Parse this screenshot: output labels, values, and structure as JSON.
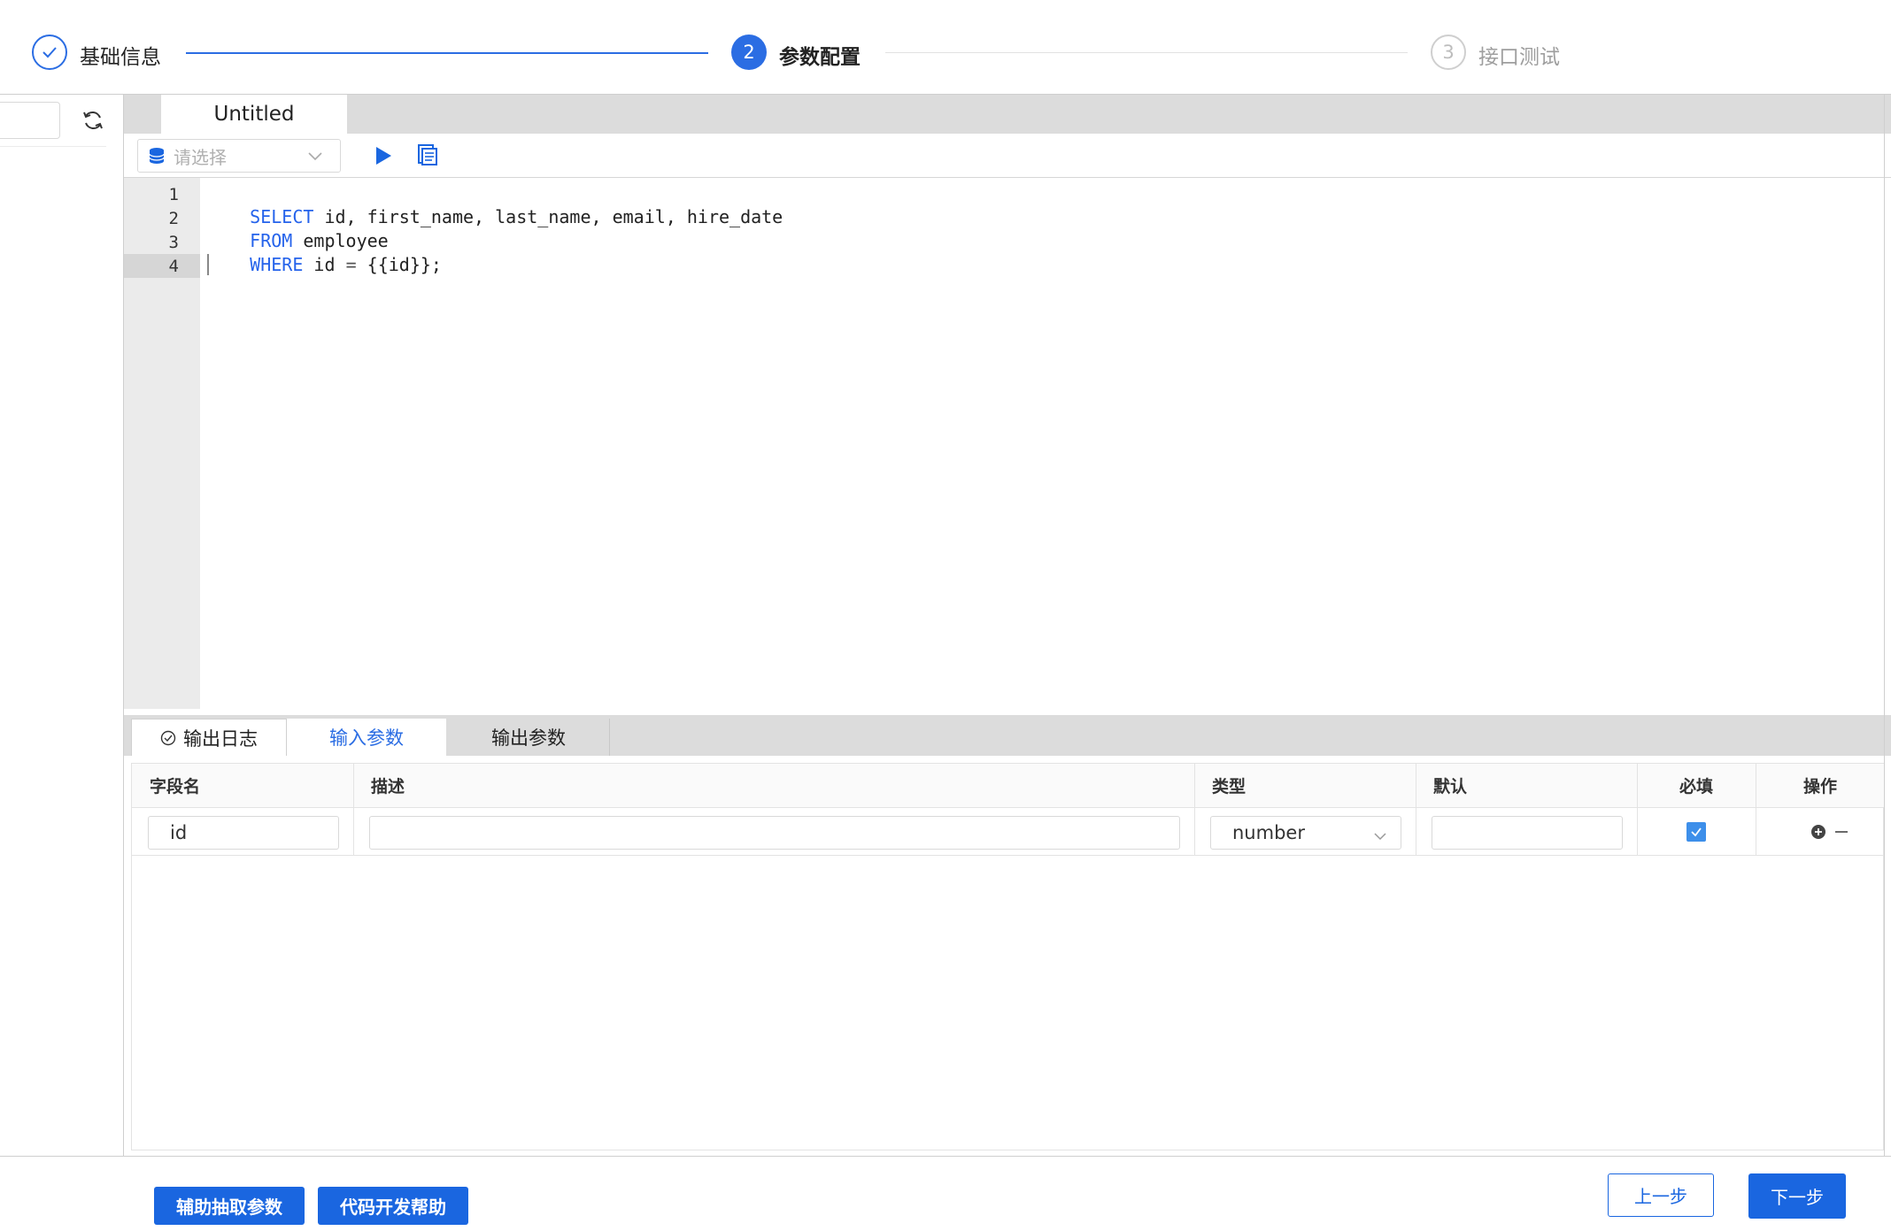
{
  "steps": [
    {
      "index": "1",
      "label": "基础信息",
      "state": "done"
    },
    {
      "index": "2",
      "label": "参数配置",
      "state": "active"
    },
    {
      "index": "3",
      "label": "接口测试",
      "state": "wait"
    }
  ],
  "editor": {
    "tab_title": "Untitled",
    "datasource_placeholder": "请选择",
    "line_numbers": [
      "1",
      "2",
      "3",
      "4"
    ],
    "code": {
      "l1_kw": "SELECT",
      "l1_rest": " id, first_name, last_name, email, hire_date",
      "l2_kw": "FROM",
      "l2_rest": " employee",
      "l3_kw": "WHERE",
      "l3_mid": " id ",
      "l3_op": "=",
      "l3_rest": " {{id}};"
    }
  },
  "bottom_tabs": [
    "输出日志",
    "输入参数",
    "输出参数"
  ],
  "table": {
    "headers": [
      "字段名",
      "描述",
      "类型",
      "默认",
      "必填",
      "操作"
    ],
    "rows": [
      {
        "field": "id",
        "description": "",
        "type": "number",
        "default": "",
        "required": true
      }
    ]
  },
  "buttons": {
    "assist_extract": "辅助抽取参数",
    "code_help": "代码开发帮助",
    "prev": "上一步",
    "next": "下一步"
  },
  "colors": {
    "accent": "#1a66e0",
    "step_accent": "#2b6de3",
    "keyword": "#2563eb"
  }
}
